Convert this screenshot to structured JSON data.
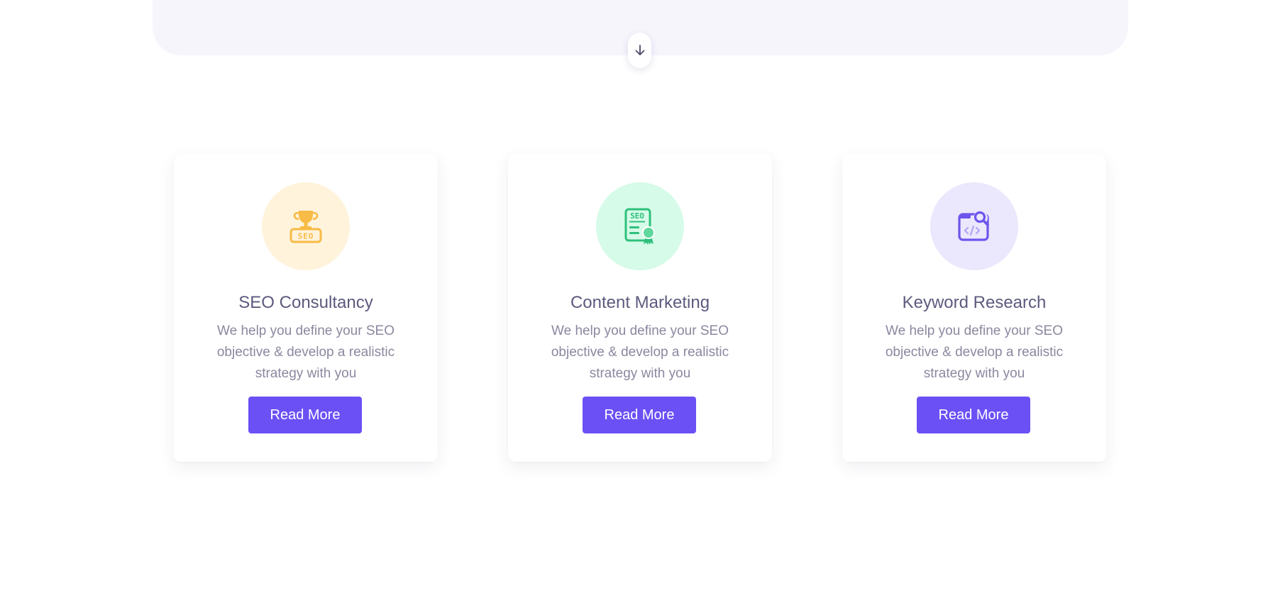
{
  "colors": {
    "accent": "#6a50f5",
    "hero_band": "#f6f5fc",
    "icon_bg_yellow": "#fff3dc",
    "icon_bg_green": "#d6fbe8",
    "icon_bg_purple": "#ebe7fd",
    "icon_yellow": "#f8bb45",
    "icon_green": "#2fc07c",
    "icon_purple": "#6d55ec"
  },
  "scroll_icon": "arrow-down-icon",
  "cards": [
    {
      "icon": "trophy-seo-icon",
      "title": "SEO Consultancy",
      "description": "We help you define your SEO objective & develop a realistic strategy with you",
      "button_label": "Read More"
    },
    {
      "icon": "seo-document-certificate-icon",
      "title": "Content Marketing",
      "description": "We help you define your SEO objective & develop a realistic strategy with you",
      "button_label": "Read More"
    },
    {
      "icon": "code-search-icon",
      "title": "Keyword Research",
      "description": "We help you define your SEO objective & develop a realistic strategy with you",
      "button_label": "Read More"
    }
  ]
}
